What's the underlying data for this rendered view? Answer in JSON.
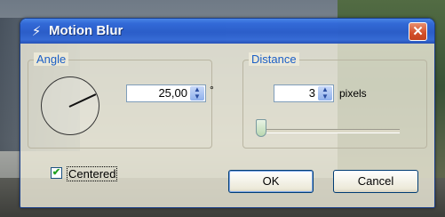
{
  "window": {
    "title": "Motion Blur",
    "close_symbol": "✕"
  },
  "angle": {
    "group_label": "Angle",
    "value": "25,00",
    "unit": "°",
    "dial_angle_degrees": 25
  },
  "distance": {
    "group_label": "Distance",
    "value": "3",
    "unit": "pixels"
  },
  "centered": {
    "label": "Centered",
    "checked": true
  },
  "buttons": {
    "ok": "OK",
    "cancel": "Cancel"
  }
}
